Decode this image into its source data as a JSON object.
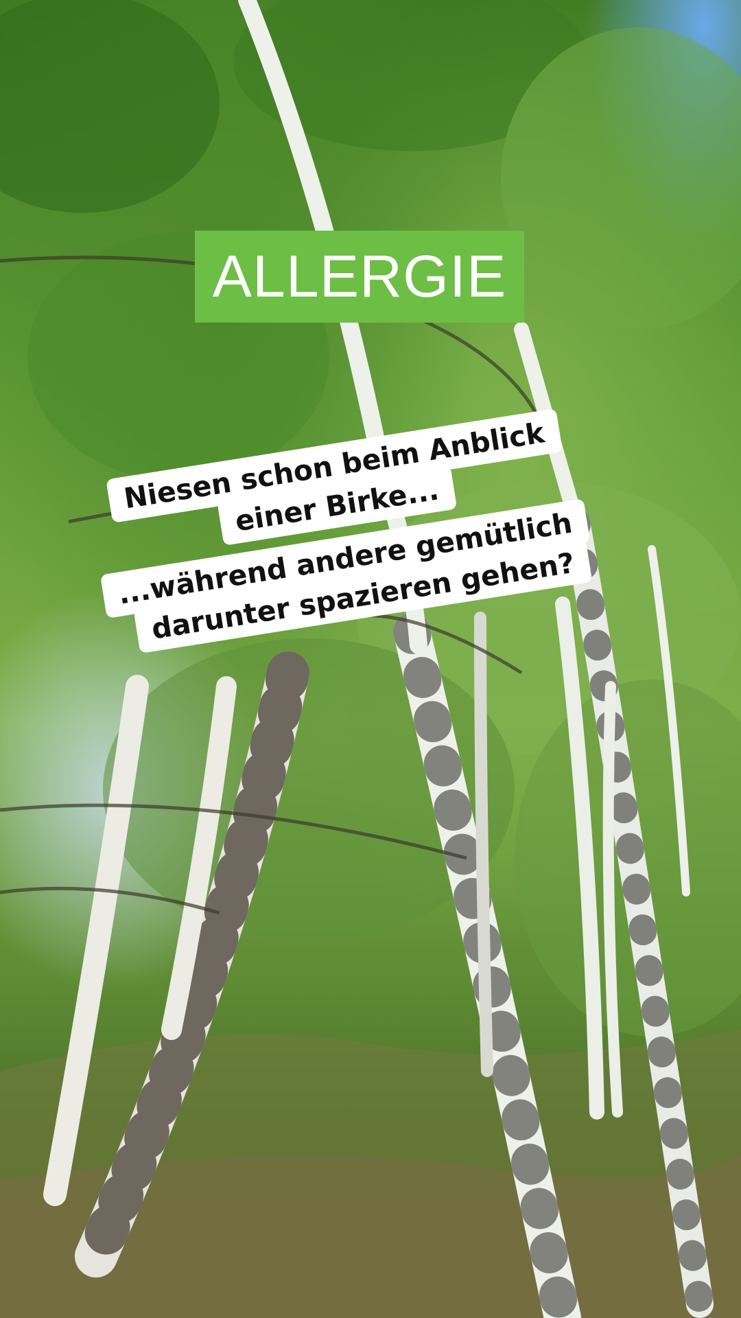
{
  "overlay": {
    "tag": "ALLERGIE",
    "caption_lines": [
      "Niesen schon beim Anblick",
      "einer Birke...",
      "...während andere gemütlich",
      "darunter spazieren gehen?"
    ]
  },
  "colors": {
    "tag_background": "#6dbe45",
    "tag_text": "#ffffff",
    "caption_background": "#ffffff",
    "caption_text": "#111111"
  },
  "scene": {
    "subject": "birch-forest-photo"
  }
}
